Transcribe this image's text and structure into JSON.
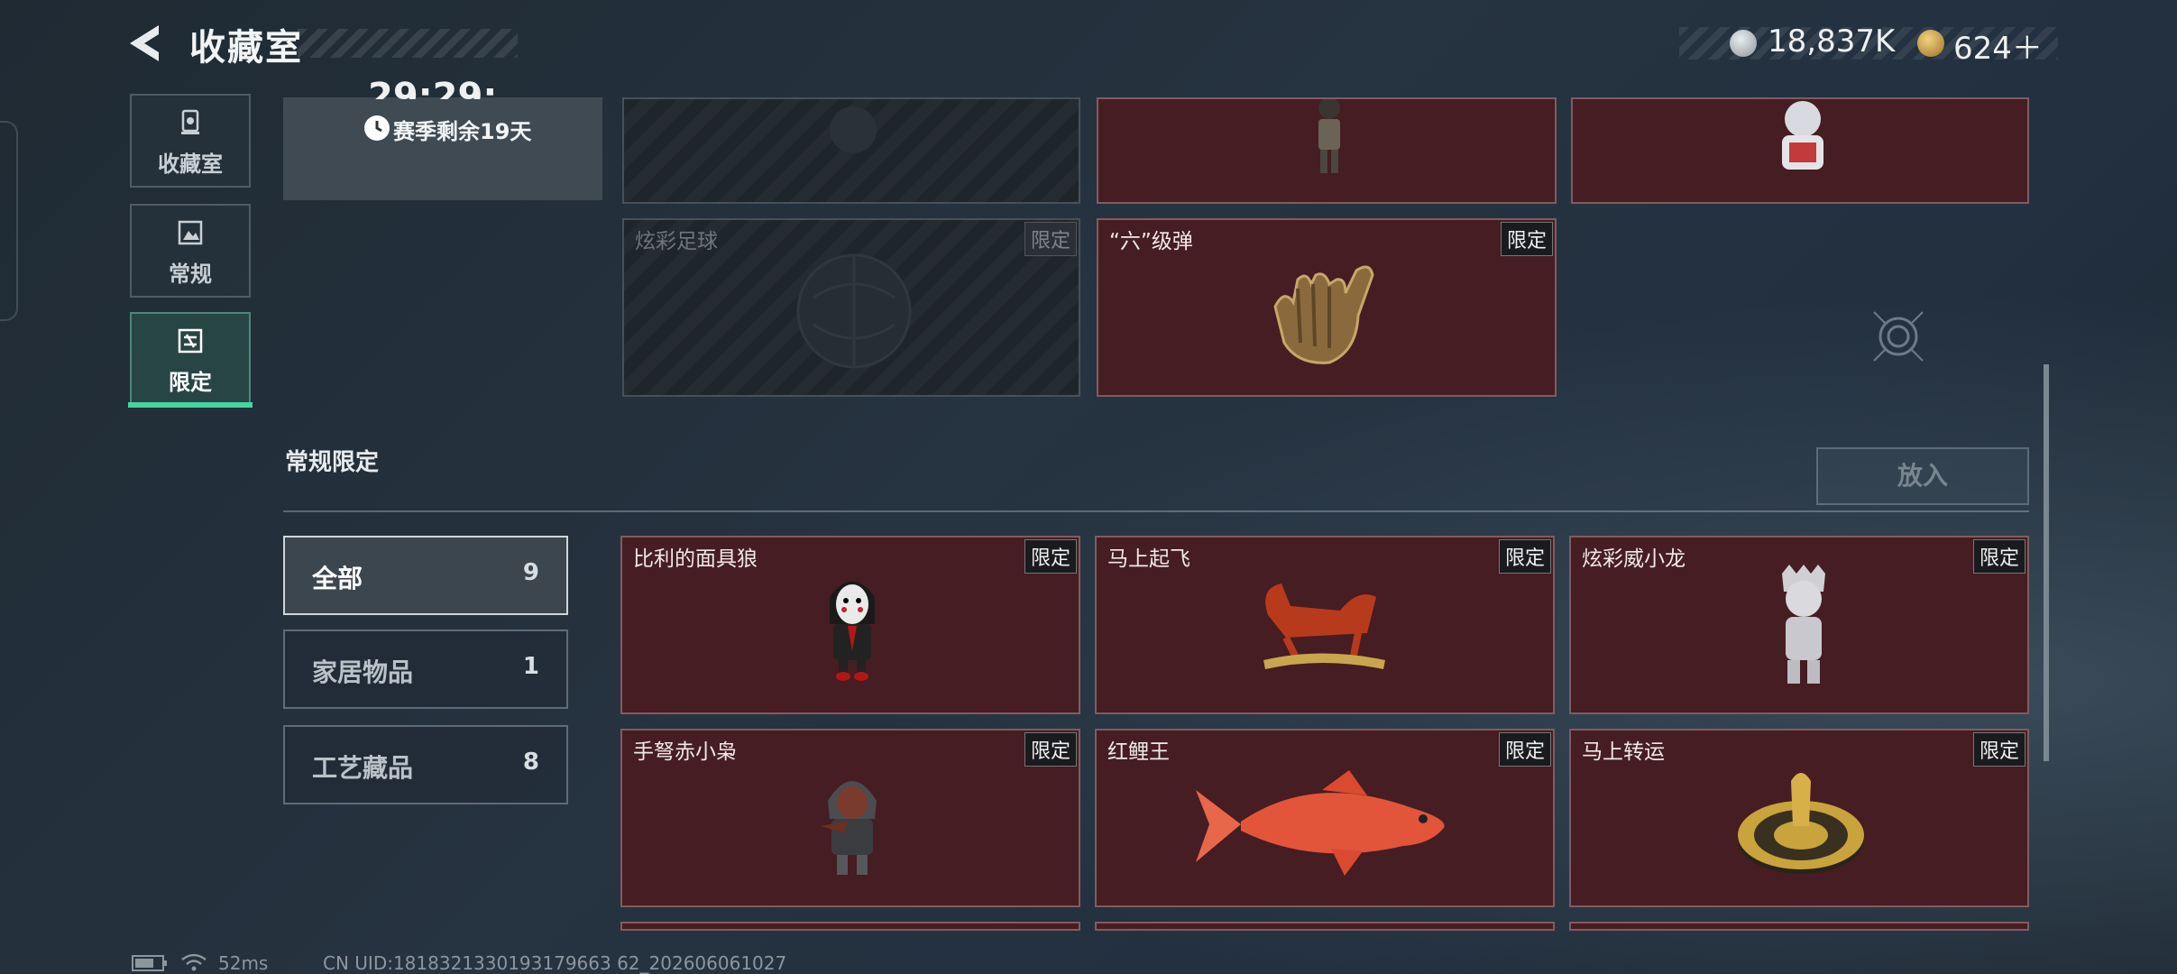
{
  "header": {
    "title": "收藏室",
    "currency": [
      {
        "icon": "silver-coin-icon",
        "value": "18,837K"
      },
      {
        "icon": "gold-coin-icon",
        "value": "624＋"
      }
    ]
  },
  "sidebar": {
    "items": [
      {
        "label": "收藏室",
        "icon": "trophy-icon"
      },
      {
        "label": "常规",
        "icon": "picture-icon"
      },
      {
        "label": "限定",
        "icon": "limited-icon"
      }
    ]
  },
  "season": {
    "top_text": "29:29:",
    "remaining": "赛季剩余19天"
  },
  "top_cards": [
    {
      "name": "",
      "badge": "",
      "locked": true,
      "icon": "figure-icon"
    },
    {
      "name": "",
      "badge": "",
      "locked": false,
      "icon": "soldier-figure-icon"
    },
    {
      "name": "",
      "badge": "",
      "locked": false,
      "icon": "mascot-figure-icon"
    },
    {
      "name": "炫彩足球",
      "badge": "限定",
      "locked": true,
      "icon": "football-icon"
    },
    {
      "name": "“六”级弹",
      "badge": "限定",
      "locked": false,
      "icon": "bullet-hand-icon"
    }
  ],
  "section": {
    "title": "常规限定",
    "place_button": "放入"
  },
  "filters": [
    {
      "label": "全部",
      "count": "9"
    },
    {
      "label": "家居物品",
      "count": "1"
    },
    {
      "label": "工艺藏品",
      "count": "8"
    }
  ],
  "items": [
    {
      "name": "比利的面具狼",
      "badge": "限定",
      "icon": "masked-doll-icon"
    },
    {
      "name": "马上起飞",
      "badge": "限定",
      "icon": "horse-icon"
    },
    {
      "name": "炫彩威小龙",
      "badge": "限定",
      "icon": "dragon-figure-icon"
    },
    {
      "name": "手弩赤小枭",
      "badge": "限定",
      "icon": "hooded-figure-icon"
    },
    {
      "name": "红鲤王",
      "badge": "限定",
      "icon": "red-carp-icon"
    },
    {
      "name": "马上转运",
      "badge": "限定",
      "icon": "gold-wheel-icon"
    }
  ],
  "footer": {
    "ping": "52ms",
    "uid": "CN UID:1818321330193179663 62_202606061027"
  }
}
